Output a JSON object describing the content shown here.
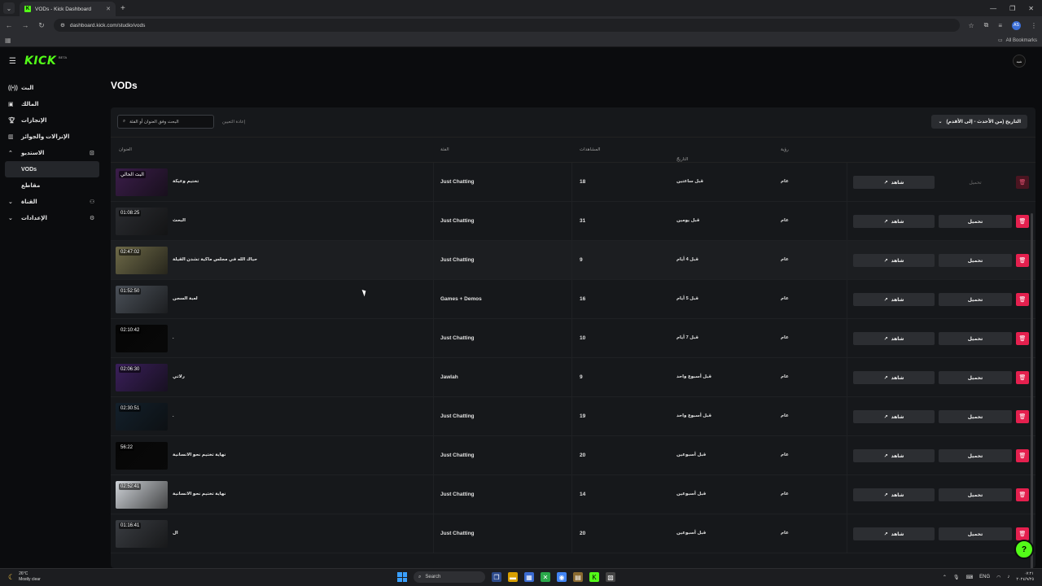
{
  "browser": {
    "tab_title": "VODs - Kick Dashboard",
    "tab_favicon": "K",
    "url": "dashboard.kick.com/studio/vods",
    "bookmarks_label": "All Bookmarks",
    "profile_initials": "AS"
  },
  "app": {
    "logo": "KICK",
    "logo_badge": "BETA",
    "user_avatar_label": "شبه"
  },
  "sidebar": {
    "items": [
      {
        "label": "البث",
        "icon": "live-icon"
      },
      {
        "label": "المالك",
        "icon": "dashboard-icon"
      },
      {
        "label": "الإنجازات",
        "icon": "trophy-icon"
      },
      {
        "label": "الإنزالات والجوائز",
        "icon": "drops-icon"
      },
      {
        "label": "الاستديو",
        "icon": "studio-icon"
      },
      {
        "label": "VODs",
        "icon": ""
      },
      {
        "label": "مقاطع",
        "icon": ""
      },
      {
        "label": "القناة",
        "icon": "channel-icon"
      },
      {
        "label": "الإعدادات",
        "icon": "settings-icon"
      }
    ]
  },
  "page": {
    "title": "VODs",
    "search_placeholder": "البحث وفق العنوان أو الفئة",
    "reset_label": "إعادة التعيين",
    "sort_label": "التاريخ (من الأحدث - إلى الأقدم)"
  },
  "table": {
    "headers": {
      "title": "العنوان",
      "category": "الفئة",
      "views": "المشاهدات",
      "date": "التاريخ",
      "visibility": "رؤية"
    },
    "watch_label": "شاهد",
    "download_label": "تحميل",
    "rows": [
      {
        "duration": "البث الحالي",
        "title": "تختيم وعيكة",
        "category": "Just Chatting",
        "views": "18",
        "date": "قبل ساعتين",
        "visibility": "عام",
        "download_enabled": false,
        "thumb_color": "#3b1d4a"
      },
      {
        "duration": "01:08:25",
        "title": "البحث",
        "category": "Just Chatting",
        "views": "31",
        "date": "قبل يومين",
        "visibility": "عام",
        "download_enabled": true,
        "thumb_color": "#2a2c30"
      },
      {
        "duration": "02:47:02",
        "title": "حياك الله في مجلس ماكية تشدن القيلة",
        "category": "Just Chatting",
        "views": "9",
        "date": "قبل 4 أيام",
        "visibility": "عام",
        "download_enabled": true,
        "thumb_color": "#6e6a48"
      },
      {
        "duration": "01:52:50",
        "title": "لعبة السجن",
        "category": "Games + Demos",
        "views": "16",
        "date": "قبل 5 أيام",
        "visibility": "عام",
        "download_enabled": true,
        "thumb_color": "#4a5058"
      },
      {
        "duration": "02:10:42",
        "title": ".",
        "category": "Just Chatting",
        "views": "10",
        "date": "قبل 7 أيام",
        "visibility": "عام",
        "download_enabled": true,
        "thumb_color": "#050505"
      },
      {
        "duration": "02:06:30",
        "title": "رلاتي",
        "category": "Jawlah",
        "views": "9",
        "date": "قبل أسبوع واحد",
        "visibility": "عام",
        "download_enabled": true,
        "thumb_color": "#3a1f5a"
      },
      {
        "duration": "02:30:51",
        "title": ".",
        "category": "Just Chatting",
        "views": "19",
        "date": "قبل أسبوع واحد",
        "visibility": "عام",
        "download_enabled": true,
        "thumb_color": "#13202b"
      },
      {
        "duration": "56:22",
        "title": "نهاية تختيم نحو الانسانية",
        "category": "Just Chatting",
        "views": "20",
        "date": "قبل أسبوعين",
        "visibility": "عام",
        "download_enabled": true,
        "thumb_color": "#060606"
      },
      {
        "duration": "02:52:41",
        "title": "نهاية تختيم نحو الانسانية",
        "category": "Just Chatting",
        "views": "14",
        "date": "قبل أسبوعين",
        "visibility": "عام",
        "download_enabled": true,
        "thumb_color": "#cfd3d8"
      },
      {
        "duration": "01:16:41",
        "title": "ال",
        "category": "Just Chatting",
        "views": "20",
        "date": "قبل أسبوعين",
        "visibility": "عام",
        "download_enabled": true,
        "thumb_color": "#3a3d42"
      }
    ]
  },
  "taskbar": {
    "temperature": "26°C",
    "weather": "Mostly clear",
    "search_label": "Search",
    "lang": "ENG",
    "time": "٠٧:٢١",
    "date": "٢٠٢٤/٩/٢٥"
  }
}
